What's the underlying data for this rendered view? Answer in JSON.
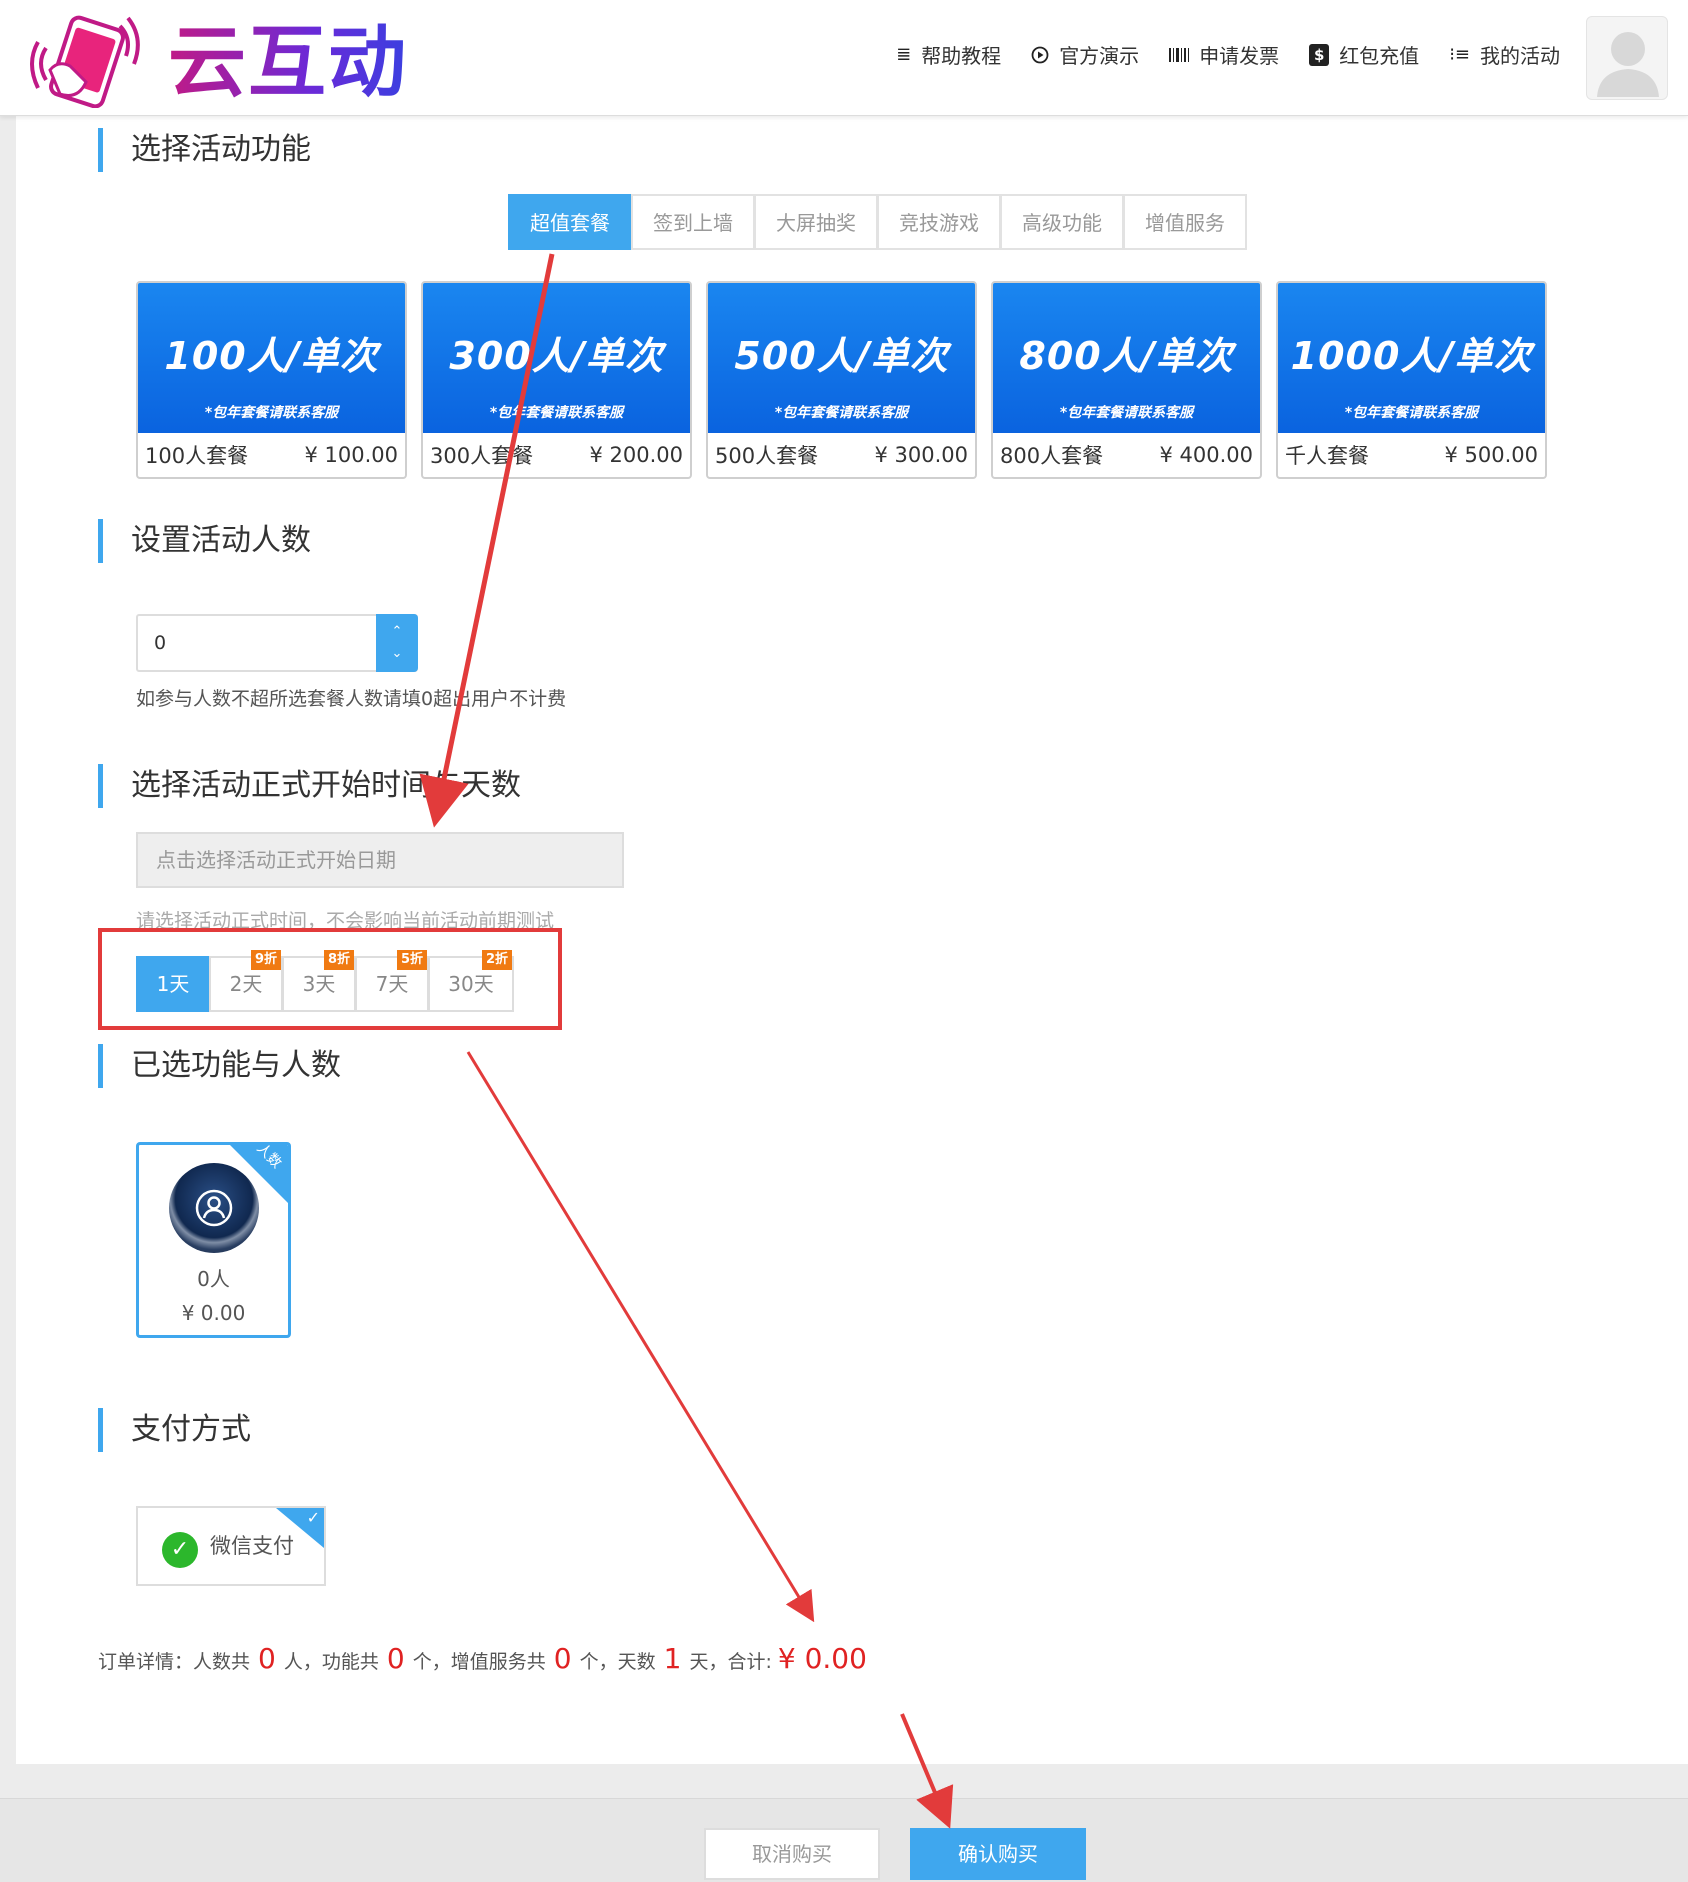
{
  "brand": {
    "name": "云互动"
  },
  "nav": [
    {
      "label": "帮助教程",
      "icon": "list-icon"
    },
    {
      "label": "官方演示",
      "icon": "play-circle-icon"
    },
    {
      "label": "申请发票",
      "icon": "barcode-icon"
    },
    {
      "label": "红包充值",
      "icon": "dollar-icon"
    },
    {
      "label": "我的活动",
      "icon": "bullet-list-icon"
    }
  ],
  "sections": {
    "functions": "选择活动功能",
    "people": "设置活动人数",
    "time": "选择活动正式开始时间与天数",
    "selected": "已选功能与人数",
    "payment": "支付方式"
  },
  "tabs": [
    "超值套餐",
    "签到上墙",
    "大屏抽奖",
    "竞技游戏",
    "高级功能",
    "增值服务"
  ],
  "active_tab": "超值套餐",
  "packages": [
    {
      "banner": "100人/单次",
      "note": "*包年套餐请联系客服",
      "name": "100人套餐",
      "price": "¥ 100.00"
    },
    {
      "banner": "300人/单次",
      "note": "*包年套餐请联系客服",
      "name": "300人套餐",
      "price": "¥ 200.00"
    },
    {
      "banner": "500人/单次",
      "note": "*包年套餐请联系客服",
      "name": "500人套餐",
      "price": "¥ 300.00"
    },
    {
      "banner": "800人/单次",
      "note": "*包年套餐请联系客服",
      "name": "800人套餐",
      "price": "¥ 400.00"
    },
    {
      "banner": "1000人/单次",
      "note": "*包年套餐请联系客服",
      "name": "千人套餐",
      "price": "¥ 500.00"
    }
  ],
  "people": {
    "value": "0",
    "up": "⌃",
    "down": "⌄",
    "hint": "如参与人数不超所选套餐人数请填0超出用户不计费"
  },
  "time": {
    "placeholder": "点击选择活动正式开始日期",
    "hint": "请选择活动正式时间，不会影响当前活动前期测试",
    "days": [
      {
        "label": "1天",
        "badge": ""
      },
      {
        "label": "2天",
        "badge": "9折"
      },
      {
        "label": "3天",
        "badge": "8折"
      },
      {
        "label": "7天",
        "badge": "5折"
      },
      {
        "label": "30天",
        "badge": "2折"
      }
    ],
    "active_day": "1天"
  },
  "selected": {
    "corner": "人数",
    "count": "0人",
    "price": "¥ 0.00"
  },
  "payment": {
    "method": "微信支付",
    "checked": true
  },
  "order": {
    "label": "订单详情：",
    "people_pre": "人数共",
    "people": "0",
    "people_unit": "人，",
    "func_pre": "功能共",
    "funcs": "0",
    "func_unit": "个，",
    "vas_pre": "增值服务共",
    "vas": "0",
    "vas_unit": "个，",
    "days_pre": "天数",
    "days": "1",
    "days_unit": "天，",
    "total_pre": "合计:",
    "total": "¥ 0.00"
  },
  "buttons": {
    "cancel": "取消购买",
    "confirm": "确认购买"
  },
  "colors": {
    "accent": "#3fa7ee",
    "highlight": "#e23b3b",
    "price": "#e02222",
    "badge": "#f07a12",
    "wechat": "#2cb72c"
  }
}
